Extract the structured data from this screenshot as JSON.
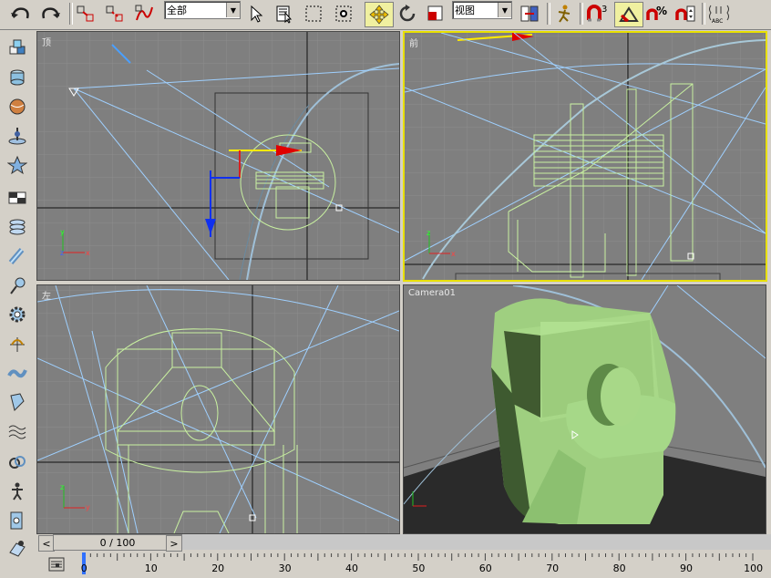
{
  "toolbar": {
    "selection_filter": "全部",
    "reference_coord": "视图",
    "snap_angle_label": "3",
    "percent_label": "%",
    "abc_label": "ABC"
  },
  "viewports": {
    "top": {
      "label": "顶"
    },
    "front": {
      "label": "前"
    },
    "left": {
      "label": "左"
    },
    "camera": {
      "label": "Camera01"
    }
  },
  "axis": {
    "x": "x",
    "y": "y",
    "z": "z"
  },
  "timeline": {
    "frame_readout": "0 / 100",
    "prev": "<",
    "next": ">",
    "ticks": [
      "0",
      "10",
      "20",
      "30",
      "40",
      "50",
      "60",
      "70",
      "80",
      "90",
      "100"
    ]
  },
  "colors": {
    "viewport_bg": "#7f7f7f",
    "grid": "#8c8c8c",
    "wire": "#c8f0a0",
    "active_border": "#e8e000",
    "light_line": "#9fd0ff",
    "model_fill": "#9fcf80"
  }
}
